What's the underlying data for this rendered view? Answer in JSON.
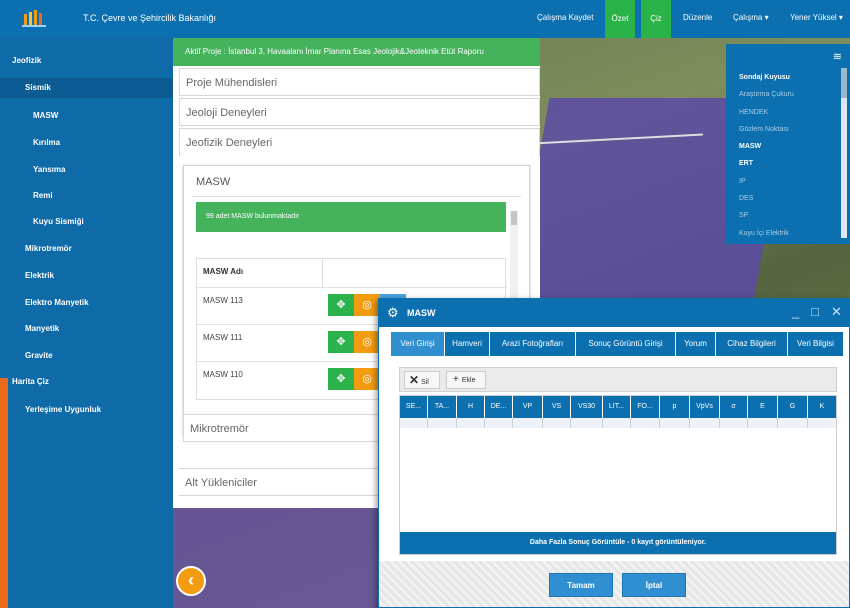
{
  "header": {
    "logo_icon": "ministry-logo-icon",
    "app_title": "T.C. Çevre ve Şehircilik Bakanlığı",
    "save_label": "Çalışma Kaydet",
    "ozet_label": "Özet",
    "ciz_label": "Çiz",
    "duzenle_label": "Düzenle",
    "calisma_label": "Çalışma ▾",
    "user_label": "Yener Yüksel ▾"
  },
  "sidebar": {
    "items": [
      {
        "label": "Jeofizik"
      },
      {
        "label": "Sismik"
      },
      {
        "label": "MASW"
      },
      {
        "label": "Kırılma"
      },
      {
        "label": "Yansıma"
      },
      {
        "label": "Remi"
      },
      {
        "label": "Kuyu Sismiği"
      },
      {
        "label": "Mikrotremör"
      },
      {
        "label": "Elektrik"
      },
      {
        "label": "Elektro Manyetik"
      },
      {
        "label": "Manyetik"
      },
      {
        "label": "Gravite"
      },
      {
        "label": "Harita Çiz"
      },
      {
        "label": "Yerleşime Uygunluk"
      }
    ]
  },
  "panel": {
    "project_banner": "Aktif Proje : İstanbul 3. Havaalanı İmar Planına Esas Jeolojik&Jeoteknik Etüt Raporu",
    "sections": {
      "proje": "Proje Mühendisleri",
      "jeoloji": "Jeoloji Deneyleri",
      "jeofizik": "Jeofizik Deneyleri",
      "mikrotremor": "Mikrotremör",
      "alt": "Alt Yükleniciler"
    },
    "masw": {
      "title": "MASW",
      "alert": "99 adet MASW bulunmaktadır",
      "column_header": "MASW Adı",
      "rows": [
        {
          "name": "MASW 113"
        },
        {
          "name": "MASW 111"
        },
        {
          "name": "MASW 110"
        }
      ]
    }
  },
  "layers": {
    "icon": "layers-icon",
    "items": [
      {
        "label": "Sondaj Kuyusu",
        "bold": true
      },
      {
        "label": "Araştırma Çukuru",
        "bold": false
      },
      {
        "label": "HENDEK",
        "bold": false
      },
      {
        "label": "Gözlem Noktası",
        "bold": false
      },
      {
        "label": "MASW",
        "bold": true
      },
      {
        "label": "ERT",
        "bold": true
      },
      {
        "label": "IP",
        "bold": false
      },
      {
        "label": "DES",
        "bold": false
      },
      {
        "label": "SP",
        "bold": false
      },
      {
        "label": "Kuyu İçi Elektrik",
        "bold": false
      }
    ]
  },
  "dialog": {
    "title": "MASW",
    "minimize": "_",
    "maximize": "□",
    "close": "✕",
    "tabs": [
      {
        "label": "Veri Girişi"
      },
      {
        "label": "Hamveri"
      },
      {
        "label": "Arazi Fotoğrafları"
      },
      {
        "label": "Sonuç Görüntü Girişi"
      },
      {
        "label": "Yorum"
      },
      {
        "label": "Cihaz Bilgileri"
      },
      {
        "label": "Veri Bilgisi"
      }
    ],
    "delete_label": "Sil",
    "add_label": "Ekle",
    "columns": [
      "SE...",
      "TA...",
      "H",
      "DE...",
      "VP",
      "VS",
      "VS30",
      "LIT...",
      "FO...",
      "p",
      "VpVs",
      "σ",
      "E",
      "G",
      "K"
    ],
    "footer": "Daha Fazla Sonuç Görüntüle - 0 kayıt görüntüleniyor.",
    "ok_label": "Tamam",
    "cancel_label": "İptal"
  },
  "colors": {
    "header_blue": "#0b6fb0",
    "success_green": "#45b25c",
    "warning_orange": "#f39c12"
  }
}
